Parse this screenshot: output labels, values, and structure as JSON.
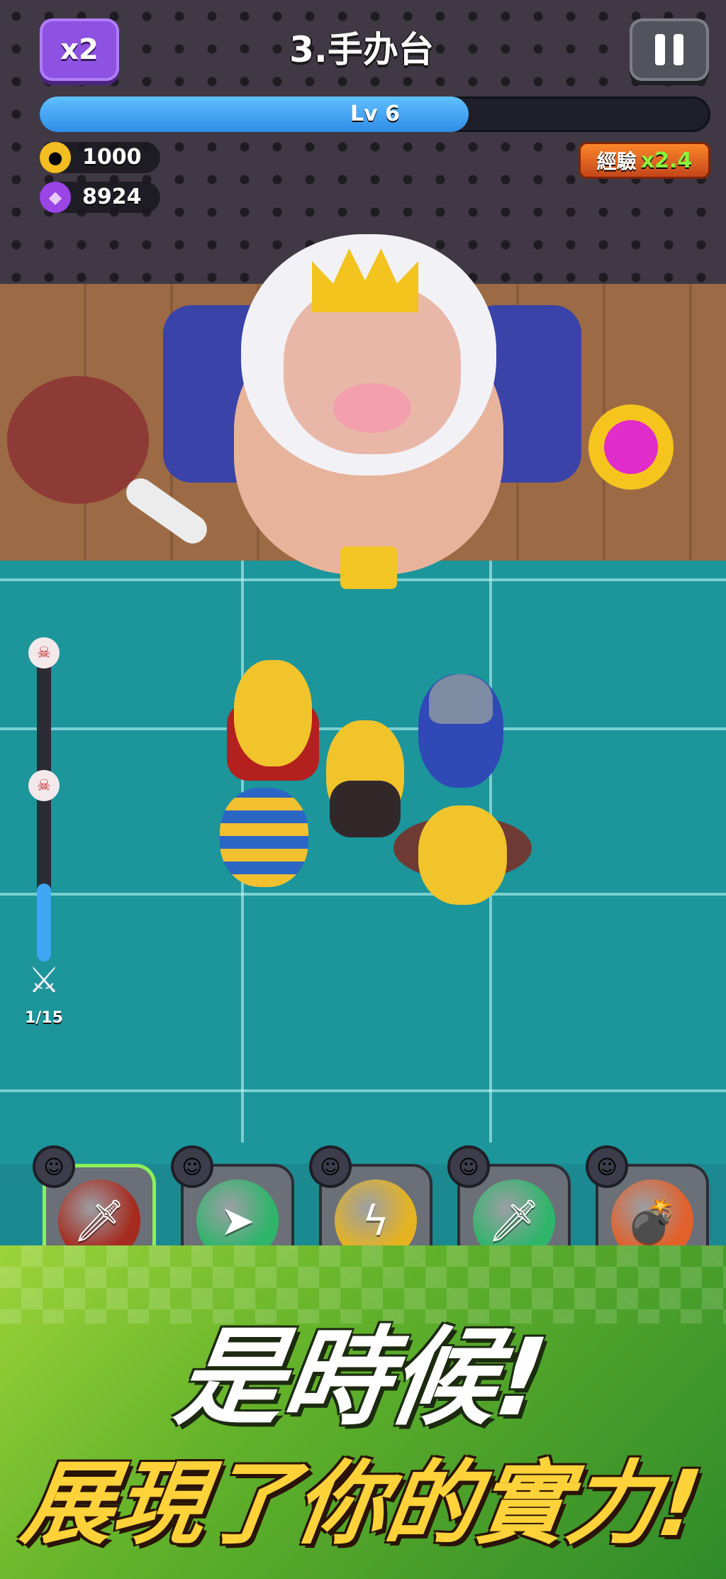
{
  "hud": {
    "speed_label": "x2",
    "stage_title": "3.手办台",
    "level_label": "Lv  6",
    "level_progress": 0.64,
    "coins": "1000",
    "gems": "8924",
    "xp_label": "經驗",
    "xp_multiplier": "x2.4"
  },
  "wave": {
    "count_label": "1/15",
    "progress": 0.25
  },
  "skills": [
    {
      "icon": "flame-sword-skill-icon",
      "glyph": "🗡",
      "color": "#a62a1e",
      "selected": true
    },
    {
      "icon": "spear-skill-icon",
      "glyph": "➤",
      "color": "#2fb56a",
      "selected": false
    },
    {
      "icon": "lightning-skill-icon",
      "glyph": "ϟ",
      "color": "#e6b320",
      "selected": false
    },
    {
      "icon": "dagger-skill-icon",
      "glyph": "🗡",
      "color": "#2fb56a",
      "selected": false
    },
    {
      "icon": "bomb-skill-icon",
      "glyph": "💣",
      "color": "#e2602a",
      "selected": false
    }
  ],
  "banner": {
    "headline_line1": "是時候!",
    "headline_line2": "展現了你的實力!"
  },
  "colors": {
    "speed_button": "#8e52e3",
    "level_fill": "#3fa6f3",
    "xp_badge": "#e8621f",
    "banner_green": "#62b22a",
    "headline_yellow": "#ffd23a"
  }
}
